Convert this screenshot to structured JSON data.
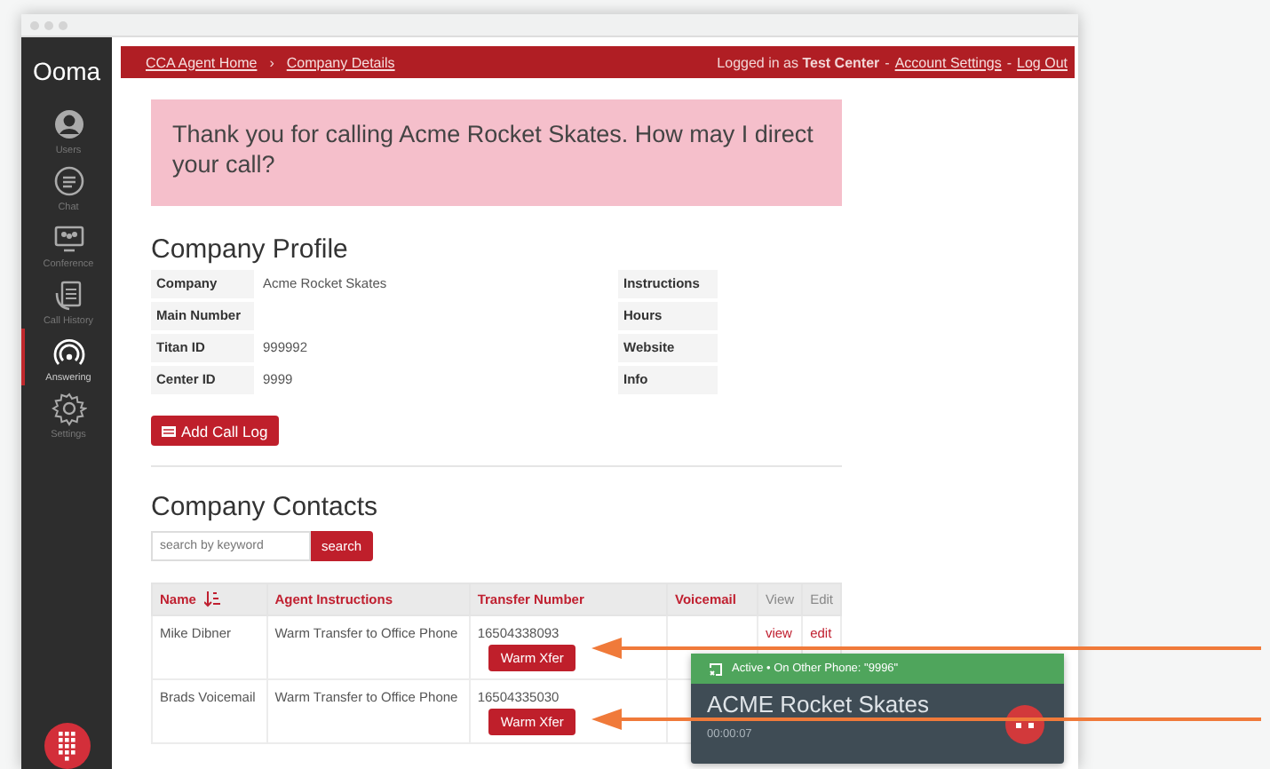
{
  "sidebar": {
    "logo": "Ooma",
    "items": [
      {
        "label": "Users",
        "selected": false
      },
      {
        "label": "Chat",
        "selected": false
      },
      {
        "label": "Conference",
        "selected": false
      },
      {
        "label": "Call History",
        "selected": false
      },
      {
        "label": "Answering",
        "selected": true
      },
      {
        "label": "Settings",
        "selected": false
      }
    ]
  },
  "header": {
    "breadcrumbs": [
      "CCA Agent Home",
      "Company Details"
    ],
    "separator": "›",
    "login_prefix": "Logged in as",
    "user": "Test Center",
    "dash": "-",
    "links": [
      "Account Settings",
      "Log Out"
    ]
  },
  "greeting": "Thank you for calling Acme Rocket Skates. How may I direct your call?",
  "profile": {
    "title": "Company Profile",
    "left": [
      {
        "label": "Company",
        "value": "Acme Rocket Skates"
      },
      {
        "label": "Main Number"
      },
      {
        "label": "Titan ID",
        "value": "999992"
      },
      {
        "label": "Center ID",
        "value": "9999"
      }
    ],
    "right": [
      {
        "label": "Instructions"
      },
      {
        "label": "Hours"
      },
      {
        "label": "Website"
      },
      {
        "label": "Info"
      }
    ],
    "button": "Add Call Log"
  },
  "contacts": {
    "title": "Company Contacts",
    "search": {
      "placeholder": "search by keyword",
      "button": "search"
    },
    "columns": [
      {
        "label": "Name",
        "sortable": true,
        "sorted": true
      },
      {
        "label": "Agent Instructions",
        "sortable": true,
        "sorted": false
      },
      {
        "label": "Transfer Number",
        "sortable": true,
        "sorted": false
      },
      {
        "label": "Voicemail",
        "sortable": true,
        "sorted": false
      },
      {
        "label": "View",
        "sortable": false,
        "sorted": false
      },
      {
        "label": "Edit",
        "sortable": false,
        "sorted": false
      }
    ],
    "rows": [
      {
        "name": "Mike Dibner",
        "instructions": "Warm Transfer to Office Phone",
        "number": "16504338093",
        "action": "Warm Xfer",
        "view": "view",
        "edit": "edit"
      },
      {
        "name": "Brads Voicemail",
        "instructions": "Warm Transfer to Office Phone",
        "number": "16504335030",
        "action": "Warm Xfer"
      }
    ]
  },
  "call": {
    "status": "Active • On Other Phone: \"9996\"",
    "title": "ACME Rocket Skates",
    "timer": "00:00:07"
  }
}
